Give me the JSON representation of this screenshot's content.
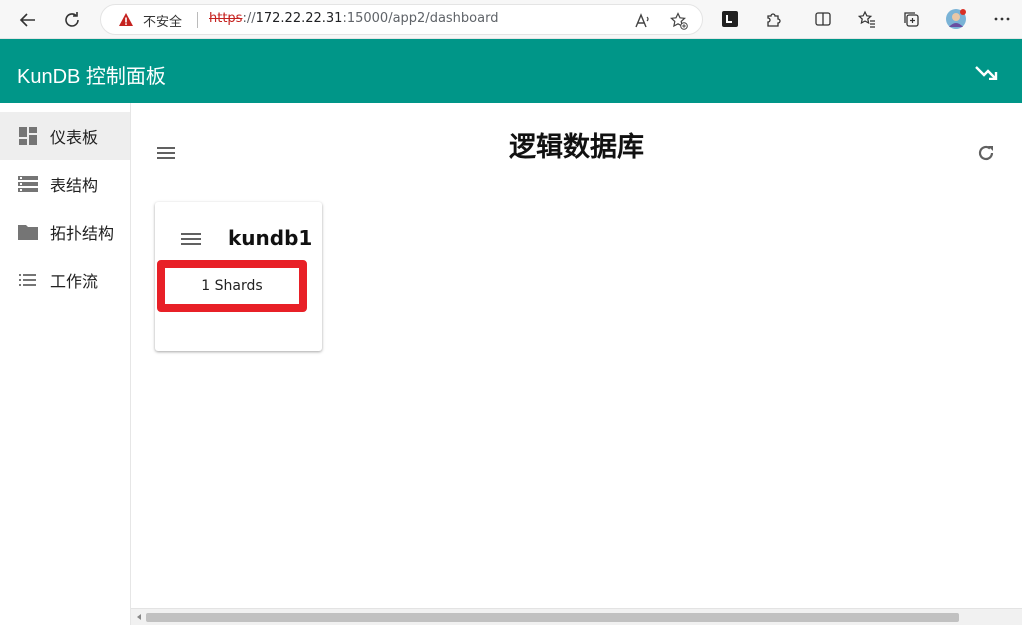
{
  "browser": {
    "insecure_label": "不安全",
    "url_protocol": "https",
    "url_sep": "://",
    "url_host": "172.22.22.31",
    "url_rest": ":15000/app2/dashboard"
  },
  "app": {
    "title": "KunDB 控制面板",
    "brand_color": "#009688"
  },
  "sidebar": {
    "items": [
      {
        "label": "仪表板",
        "icon": "dashboard-icon",
        "active": true
      },
      {
        "label": "表结构",
        "icon": "storage-icon",
        "active": false
      },
      {
        "label": "拓扑结构",
        "icon": "folder-icon",
        "active": false
      },
      {
        "label": "工作流",
        "icon": "list-icon",
        "active": false
      }
    ]
  },
  "main": {
    "title": "逻辑数据库",
    "cards": [
      {
        "name": "kundb1",
        "shards_label": "1 Shards",
        "highlight_color": "#e82027"
      }
    ]
  }
}
